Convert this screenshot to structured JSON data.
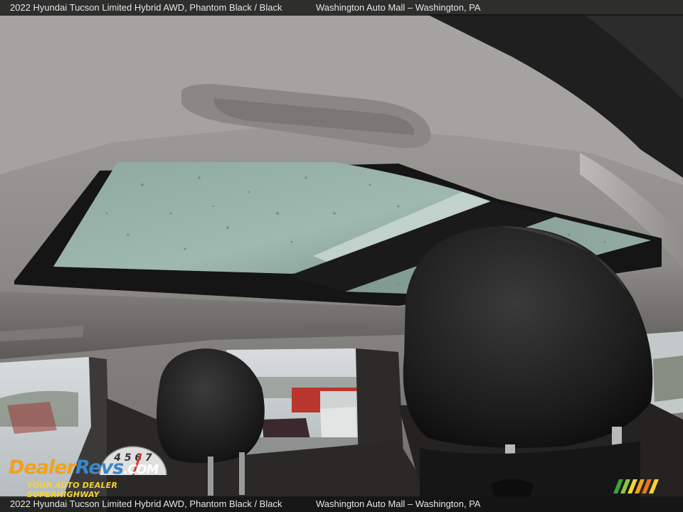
{
  "caption": {
    "vehicle": "2022 Hyundai Tucson Limited Hybrid AWD,  Phantom Black / Black",
    "dealer": "Washington Auto Mall – Washington, PA"
  },
  "watermark": {
    "part1": "Dealer",
    "part2": "Revs",
    "part3": ".COM",
    "tagline": "YOUR AUTO DEALER SUPERHIGHWAY",
    "gauge_digits": "4 5 6 7"
  },
  "colors": {
    "logo_orange": "#f2a11b",
    "logo_blue": "#3d86c9",
    "tagline_yellow": "#f7d235"
  }
}
